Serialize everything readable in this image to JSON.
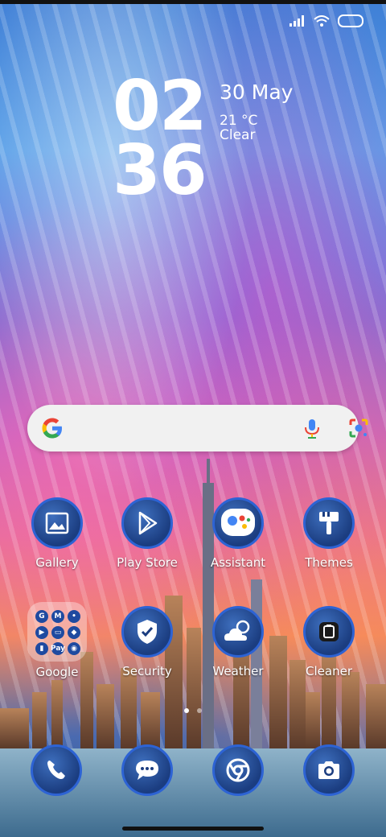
{
  "clock": {
    "hour": "02",
    "minute": "36"
  },
  "weather": {
    "date": "30 May",
    "temperature": "21 °C",
    "condition": "Clear"
  },
  "apps_row1": [
    {
      "label": "Gallery",
      "icon": "gallery-icon"
    },
    {
      "label": "Play Store",
      "icon": "play-store-icon"
    },
    {
      "label": "Assistant",
      "icon": "assistant-icon"
    },
    {
      "label": "Themes",
      "icon": "themes-icon"
    }
  ],
  "apps_row2": [
    {
      "label": "Google",
      "icon": "google-folder-icon"
    },
    {
      "label": "Security",
      "icon": "security-icon"
    },
    {
      "label": "Weather",
      "icon": "weather-icon"
    },
    {
      "label": "Cleaner",
      "icon": "cleaner-icon"
    }
  ],
  "folder_minis": [
    "G",
    "M",
    "•",
    "▶",
    "▭",
    "◆",
    "▮",
    "Pay",
    "◉"
  ],
  "dock": [
    {
      "icon": "phone-icon"
    },
    {
      "icon": "messages-icon"
    },
    {
      "icon": "chrome-icon"
    },
    {
      "icon": "camera-icon"
    }
  ],
  "colors": {
    "icon_bg": "#1b3d80",
    "icon_ring": "#2d63d4"
  }
}
